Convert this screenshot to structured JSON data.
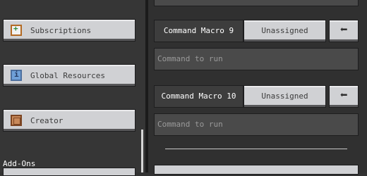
{
  "sidebar": {
    "items": [
      {
        "label": "Subscriptions",
        "icon": "subscriptions-icon"
      },
      {
        "label": "Global Resources",
        "icon": "global-resources-icon"
      },
      {
        "label": "Creator",
        "icon": "creator-icon"
      }
    ],
    "section_label": "Add-Ons"
  },
  "macros": [
    {
      "name": "Command Macro 9",
      "assignment": "Unassigned",
      "placeholder": "Command to run"
    },
    {
      "name": "Command Macro 10",
      "assignment": "Unassigned",
      "placeholder": "Command to run"
    }
  ],
  "colors": {
    "panel_bg": "#303030",
    "sidebar_bg": "#363636",
    "button_face": "#d0d1d4",
    "input_bg": "#4a4a4a"
  }
}
